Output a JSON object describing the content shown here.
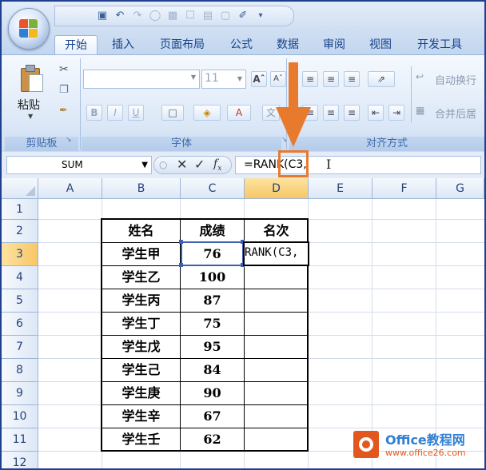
{
  "tabs": [
    "开始",
    "插入",
    "页面布局",
    "公式",
    "数据",
    "审阅",
    "视图",
    "开发工具"
  ],
  "ribbon": {
    "paste_label": "粘贴",
    "font_size": "11",
    "wrap_text": "自动换行",
    "merge_center": "合并后居",
    "groups": [
      "剪贴板",
      "字体",
      "对齐方式"
    ]
  },
  "name_box": "SUM",
  "formula": "=RANK(C3,",
  "columns": [
    "A",
    "B",
    "C",
    "D",
    "E",
    "F",
    "G"
  ],
  "rows": [
    "1",
    "2",
    "3",
    "4",
    "5",
    "6",
    "7",
    "8",
    "9",
    "10",
    "11",
    "12"
  ],
  "table": {
    "headers": [
      "姓名",
      "成绩",
      "名次"
    ],
    "names": [
      "学生甲",
      "学生乙",
      "学生丙",
      "学生丁",
      "学生戊",
      "学生己",
      "学生庚",
      "学生辛",
      "学生壬"
    ],
    "scores": [
      "76",
      "100",
      "87",
      "75",
      "95",
      "84",
      "90",
      "67",
      "62"
    ]
  },
  "active_cell_text": "RANK(C3,",
  "watermark": {
    "brand": "Office教程网",
    "url": "www.office26.com"
  },
  "colors": {
    "accent_orange": "#e87a2e",
    "selection_blue": "#3c5fb1"
  }
}
